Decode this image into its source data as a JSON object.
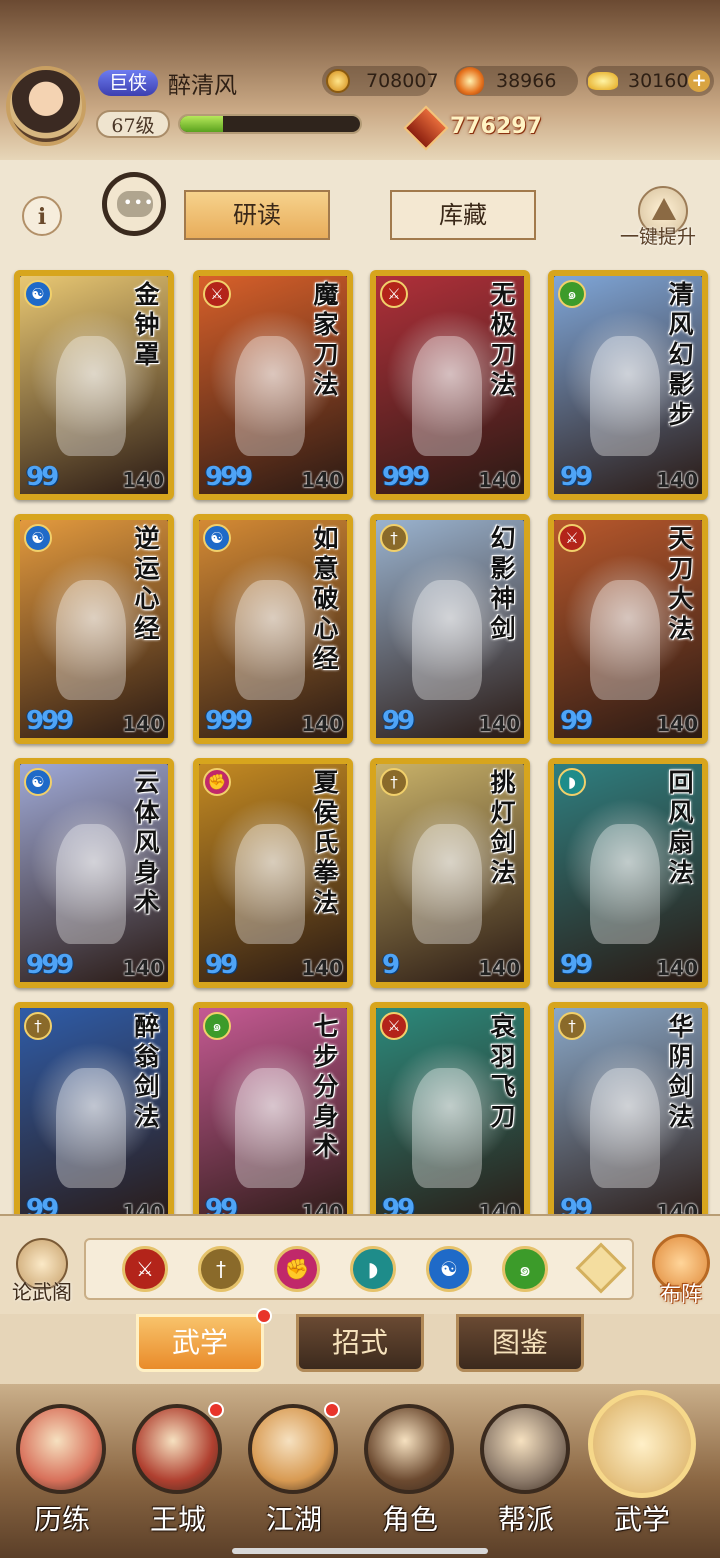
{
  "player": {
    "title_badge": "巨侠",
    "name": "醉清风",
    "level": "67级",
    "exp_progress": 0.24,
    "combat_power": "776297"
  },
  "currencies": [
    {
      "icon": "copper-coin-icon",
      "value": "708007"
    },
    {
      "icon": "flame-token-icon",
      "value": "38966"
    },
    {
      "icon": "gold-ingot-icon",
      "value": "30160"
    }
  ],
  "controls": {
    "info": "i",
    "tabs": [
      "研读",
      "库藏"
    ],
    "upgrade_all": "一键提升"
  },
  "cards": [
    {
      "name": "金钟罩",
      "type": "blue",
      "type_icon": "yin-yang-icon",
      "quality": "99",
      "level": "140",
      "bg": "#e9c873"
    },
    {
      "name": "魔家刀法",
      "type": "red",
      "type_icon": "blade-icon",
      "quality": "999",
      "level": "140",
      "bg": "#d8602a"
    },
    {
      "name": "无极刀法",
      "type": "red",
      "type_icon": "blade-icon",
      "quality": "999",
      "level": "140",
      "bg": "#b0303a"
    },
    {
      "name": "清风幻影步",
      "type": "green",
      "type_icon": "wind-icon",
      "quality": "99",
      "level": "140",
      "bg": "#7fa6d8"
    },
    {
      "name": "逆运心经",
      "type": "blue",
      "type_icon": "yin-yang-icon",
      "quality": "999",
      "level": "140",
      "bg": "#e39a3e"
    },
    {
      "name": "如意破心经",
      "type": "blue",
      "type_icon": "yin-yang-icon",
      "quality": "999",
      "level": "140",
      "bg": "#d48a34"
    },
    {
      "name": "幻影神剑",
      "type": "gold",
      "type_icon": "sword-icon",
      "quality": "99",
      "level": "140",
      "bg": "#9ab3cf"
    },
    {
      "name": "天刀大法",
      "type": "red",
      "type_icon": "blade-icon",
      "quality": "99",
      "level": "140",
      "bg": "#b8582c"
    },
    {
      "name": "云体风身术",
      "type": "blue",
      "type_icon": "yin-yang-icon",
      "quality": "999",
      "level": "140",
      "bg": "#9fa9d6"
    },
    {
      "name": "夏侯氏拳法",
      "type": "pink",
      "type_icon": "fist-icon",
      "quality": "99",
      "level": "140",
      "bg": "#c48a22"
    },
    {
      "name": "挑灯剑法",
      "type": "gold",
      "type_icon": "sword-icon",
      "quality": "9",
      "level": "140",
      "bg": "#c9b269"
    },
    {
      "name": "回风扇法",
      "type": "teal",
      "type_icon": "fan-icon",
      "quality": "99",
      "level": "140",
      "bg": "#2f7f80"
    },
    {
      "name": "醉翁剑法",
      "type": "gold",
      "type_icon": "sword-icon",
      "quality": "99",
      "level": "140",
      "bg": "#2f5ca8"
    },
    {
      "name": "七步分身术",
      "type": "green",
      "type_icon": "wind-icon",
      "quality": "99",
      "level": "140",
      "bg": "#c55a93"
    },
    {
      "name": "哀羽飞刀",
      "type": "red",
      "type_icon": "blade-icon",
      "quality": "99",
      "level": "140",
      "bg": "#2c8a7c"
    },
    {
      "name": "华阴剑法",
      "type": "gold",
      "type_icon": "sword-icon",
      "quality": "99",
      "level": "140",
      "bg": "#8aa8c8"
    }
  ],
  "filter": {
    "left_label": "论武阁",
    "right_label": "布阵",
    "icons": [
      {
        "name": "blade-filter-icon",
        "color": "red",
        "glyph": "⚔"
      },
      {
        "name": "sword-filter-icon",
        "color": "gold",
        "glyph": "†"
      },
      {
        "name": "fist-filter-icon",
        "color": "pink",
        "glyph": "✊"
      },
      {
        "name": "fan-filter-icon",
        "color": "teal",
        "glyph": "◗"
      },
      {
        "name": "yin-yang-filter-icon",
        "color": "blue",
        "glyph": "☯"
      },
      {
        "name": "wind-filter-icon",
        "color": "green",
        "glyph": "๑"
      },
      {
        "name": "all-filter-icon",
        "color": "gold",
        "glyph": ""
      }
    ]
  },
  "subtabs": [
    "武学",
    "招式",
    "图鉴"
  ],
  "nav": [
    "历练",
    "王城",
    "江湖",
    "角色",
    "帮派",
    "武学"
  ],
  "colors": {
    "red": "#b3241a",
    "gold": "#8a6a2a",
    "pink": "#c0286a",
    "teal": "#1e8c8a",
    "blue": "#1f6ac8",
    "green": "#3c9b2a",
    "card_border": "#d7a51d",
    "accent": "#e98b2a"
  }
}
